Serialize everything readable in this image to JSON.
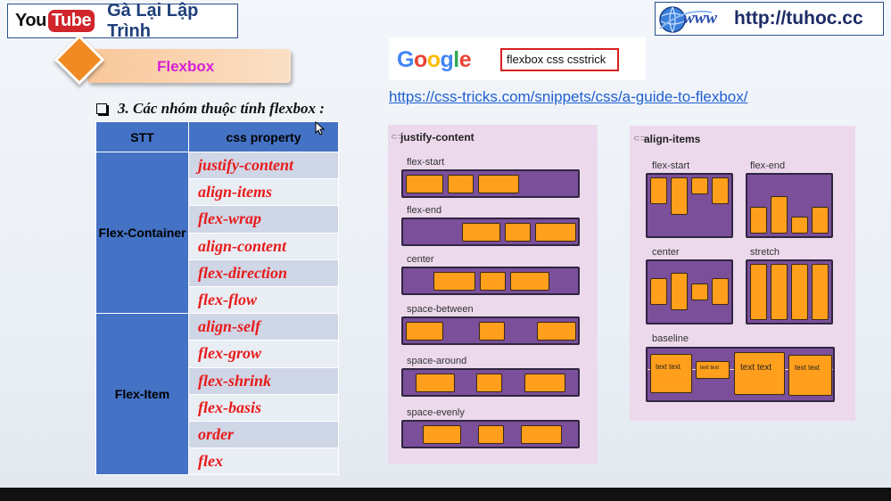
{
  "header": {
    "youtube_you": "You",
    "youtube_tube": "Tube",
    "channel_name": "Gà Lại Lập Trình",
    "www_text": "www",
    "site_url": "http://tuhoc.cc"
  },
  "badge": {
    "title": "Flexbox"
  },
  "section_heading": "3. Các nhóm thuộc tính flexbox :",
  "table": {
    "headers": [
      "STT",
      "css property"
    ],
    "groups": [
      {
        "name": "Flex-Container",
        "props": [
          "justify-content",
          "align-items",
          "flex-wrap",
          "align-content",
          "flex-direction",
          "flex-flow"
        ]
      },
      {
        "name": "Flex-Item",
        "props": [
          "align-self",
          "flex-grow",
          "flex-shrink",
          "flex-basis",
          "order",
          "flex"
        ]
      }
    ]
  },
  "google": {
    "logo_letters": [
      {
        "ch": "G",
        "color": "#4285f4"
      },
      {
        "ch": "o",
        "color": "#ea4335"
      },
      {
        "ch": "o",
        "color": "#fbbc05"
      },
      {
        "ch": "g",
        "color": "#4285f4"
      },
      {
        "ch": "l",
        "color": "#34a853"
      },
      {
        "ch": "e",
        "color": "#ea4335"
      }
    ],
    "search_query": "flexbox css csstrick"
  },
  "link_url": "https://css-tricks.com/snippets/css/a-guide-to-flexbox/",
  "justify_panel": {
    "title": "justify-content",
    "rows": [
      "flex-start",
      "flex-end",
      "center",
      "space-between",
      "space-around",
      "space-evenly"
    ]
  },
  "align_panel": {
    "title": "align-items",
    "cells": [
      "flex-start",
      "flex-end",
      "center",
      "stretch"
    ],
    "baseline_label": "baseline",
    "baseline_items": [
      "text text",
      "text text",
      "text text",
      "text text"
    ]
  },
  "colors": {
    "accent_blue": "#4472c4",
    "property_red": "#e81b1b",
    "flex_item_orange": "#ff9f1c",
    "flex_container_purple": "#7b4f9a",
    "panel_pink": "#ecd9ec"
  }
}
